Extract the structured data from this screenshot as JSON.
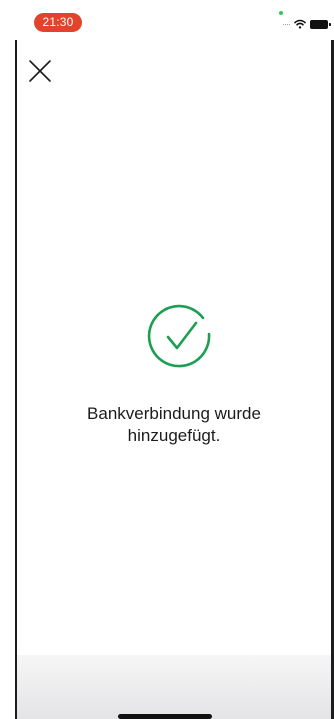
{
  "status_bar": {
    "time": "21:30",
    "signal_icon": "cellular-dots-icon",
    "wifi_icon": "wifi-icon",
    "battery_icon": "battery-icon"
  },
  "header": {
    "close_icon": "close-icon"
  },
  "main": {
    "success_icon": "checkmark-circle-icon",
    "accent_color": "#1e9e52",
    "message": "Bankverbindung wurde\nhinzugefügt."
  },
  "colors": {
    "time_pill": "#e3422c",
    "background": "#ffffff",
    "text": "#1c1c1e"
  }
}
